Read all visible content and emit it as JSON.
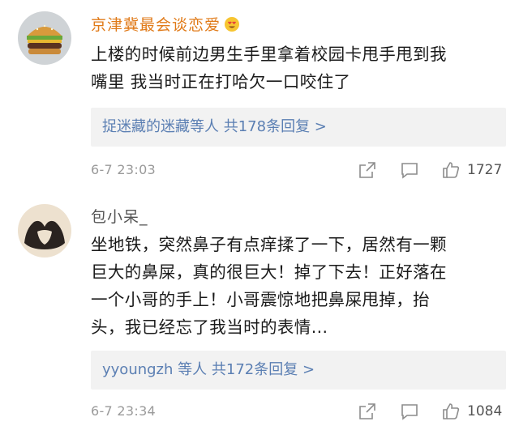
{
  "comments": [
    {
      "username": "京津冀最会谈恋爱",
      "username_color": "#e07a18",
      "emoji_icon": "heart-eyes-emoji",
      "avatar_icon": "burger-avatar",
      "content_lines": [
        "上楼的时候前边男生手里拿着校园卡甩手甩到我",
        "嘴里 我当时正在打哈欠一口咬住了"
      ],
      "replies": {
        "names": "捉迷藏的迷藏",
        "suffix": "等人 共178条回复 >"
      },
      "time": "6-7 23:03",
      "likes": "1727"
    },
    {
      "username": "包小呆_",
      "username_color": "#555555",
      "avatar_icon": "heart-hands-avatar",
      "content_lines": [
        "坐地铁，突然鼻子有点痒揉了一下，居然有一颗",
        "巨大的鼻屎，真的很巨大！掉了下去！正好落在",
        "一个小哥的手上！小哥震惊地把鼻屎甩掉，抬",
        "头，我已经忘了我当时的表情..."
      ],
      "replies": {
        "names": "yyoungzh",
        "suffix": "等人 共172条回复 >"
      },
      "time": "6-7 23:34",
      "likes": "1084"
    }
  ],
  "colors": {
    "link": "#5b7fb3",
    "meta": "#9a9a9a",
    "reply_bg": "#f2f2f2"
  }
}
